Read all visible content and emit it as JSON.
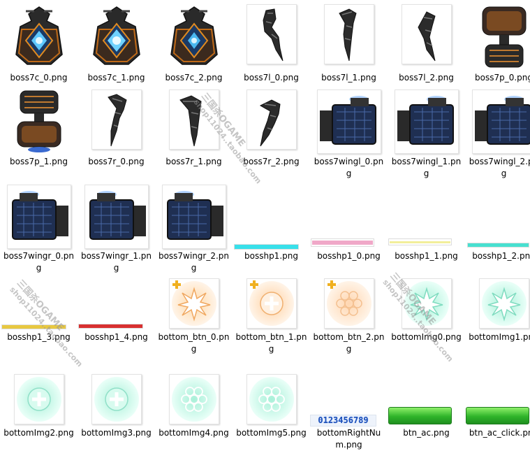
{
  "files": [
    {
      "name": "boss7c_0.png",
      "icon": "boss-core-icon"
    },
    {
      "name": "boss7c_1.png",
      "icon": "boss-core-icon"
    },
    {
      "name": "boss7c_2.png",
      "icon": "boss-core-icon"
    },
    {
      "name": "boss7l_0.png",
      "icon": "claw-left-icon"
    },
    {
      "name": "boss7l_1.png",
      "icon": "claw-left-icon"
    },
    {
      "name": "boss7l_2.png",
      "icon": "claw-left-icon"
    },
    {
      "name": "boss7p_0.png",
      "icon": "boss-pod-icon"
    },
    {
      "name": "boss7p_1.png",
      "icon": "boss-pod-icon"
    },
    {
      "name": "boss7r_0.png",
      "icon": "claw-right-icon"
    },
    {
      "name": "boss7r_1.png",
      "icon": "claw-right-icon"
    },
    {
      "name": "boss7r_2.png",
      "icon": "claw-right-icon"
    },
    {
      "name": "boss7wingl_0.png",
      "icon": "wing-left-icon"
    },
    {
      "name": "boss7wingl_1.png",
      "icon": "wing-left-icon"
    },
    {
      "name": "boss7wingl_2.png",
      "icon": "wing-left-icon"
    },
    {
      "name": "boss7wingr_0.png",
      "icon": "wing-right-icon"
    },
    {
      "name": "boss7wingr_1.png",
      "icon": "wing-right-icon"
    },
    {
      "name": "boss7wingr_2.png",
      "icon": "wing-right-icon"
    },
    {
      "name": "bosshp1.png",
      "icon": "hp-bar-icon",
      "color": "#38e0ea"
    },
    {
      "name": "bosshp1_0.png",
      "icon": "hp-bar-icon",
      "color": "#f0a8c8"
    },
    {
      "name": "bosshp1_1.png",
      "icon": "hp-bar-icon",
      "color": "#f2ee9a"
    },
    {
      "name": "bosshp1_2.png",
      "icon": "hp-bar-icon",
      "color": "#48e0d0"
    },
    {
      "name": "bosshp1_3.png",
      "icon": "hp-bar-icon",
      "color": "#e8c840"
    },
    {
      "name": "bosshp1_4.png",
      "icon": "hp-bar-icon",
      "color": "#d83030"
    },
    {
      "name": "bottom_btn_0.png",
      "icon": "orange-burst-button-icon"
    },
    {
      "name": "bottom_btn_1.png",
      "icon": "orange-plus-button-icon"
    },
    {
      "name": "bottom_btn_2.png",
      "icon": "orange-hex-button-icon"
    },
    {
      "name": "bottomImg0.png",
      "icon": "green-burst-icon"
    },
    {
      "name": "bottomImg1.png",
      "icon": "green-burst-icon"
    },
    {
      "name": "bottomImg2.png",
      "icon": "green-plus-icon"
    },
    {
      "name": "bottomImg3.png",
      "icon": "green-plus-icon"
    },
    {
      "name": "bottomImg4.png",
      "icon": "green-hex-icon"
    },
    {
      "name": "bottomImg5.png",
      "icon": "green-hex-icon"
    },
    {
      "name": "bottomRightNum.png",
      "icon": "digit-strip-icon",
      "text": "0123456789"
    },
    {
      "name": "btn_ac.png",
      "icon": "green-button-icon"
    },
    {
      "name": "btn_ac_click.png",
      "icon": "green-button-icon"
    }
  ],
  "watermark": {
    "line1": "三国杀OGAME",
    "line2": "shop11024..taobao.com"
  }
}
